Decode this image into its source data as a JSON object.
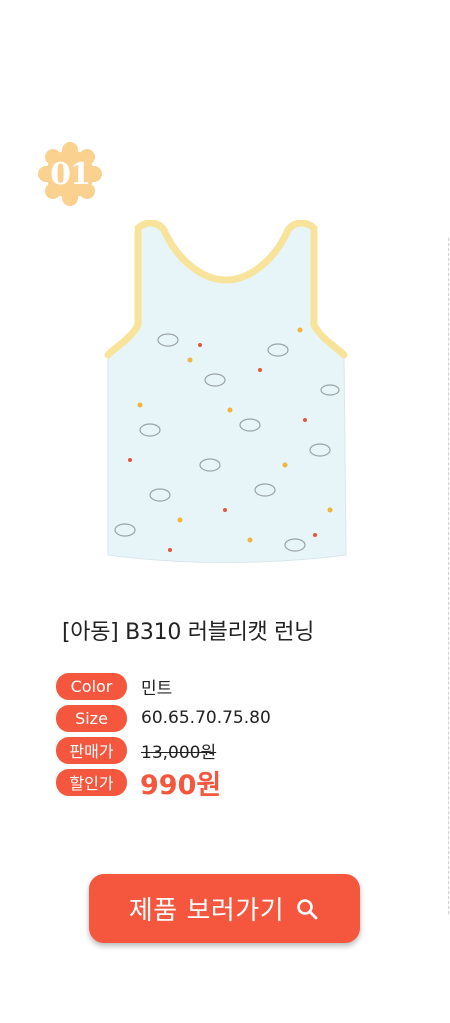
{
  "badge": {
    "number": "01"
  },
  "product": {
    "title": "[아동] B310 러블리캣 런닝",
    "specs": [
      {
        "label": "Color",
        "value": "민트"
      },
      {
        "label": "Size",
        "value": "60.65.70.75.80"
      },
      {
        "label": "판매가",
        "value": "13,000원"
      },
      {
        "label": "할인가",
        "value": "990원"
      }
    ]
  },
  "cta": {
    "label": "제품 보러가기",
    "icon": "search-icon"
  },
  "colors": {
    "accent": "#f4573d",
    "badge": "#fbd190",
    "garment": "#e8f5f8",
    "trim": "#f7e39a"
  }
}
